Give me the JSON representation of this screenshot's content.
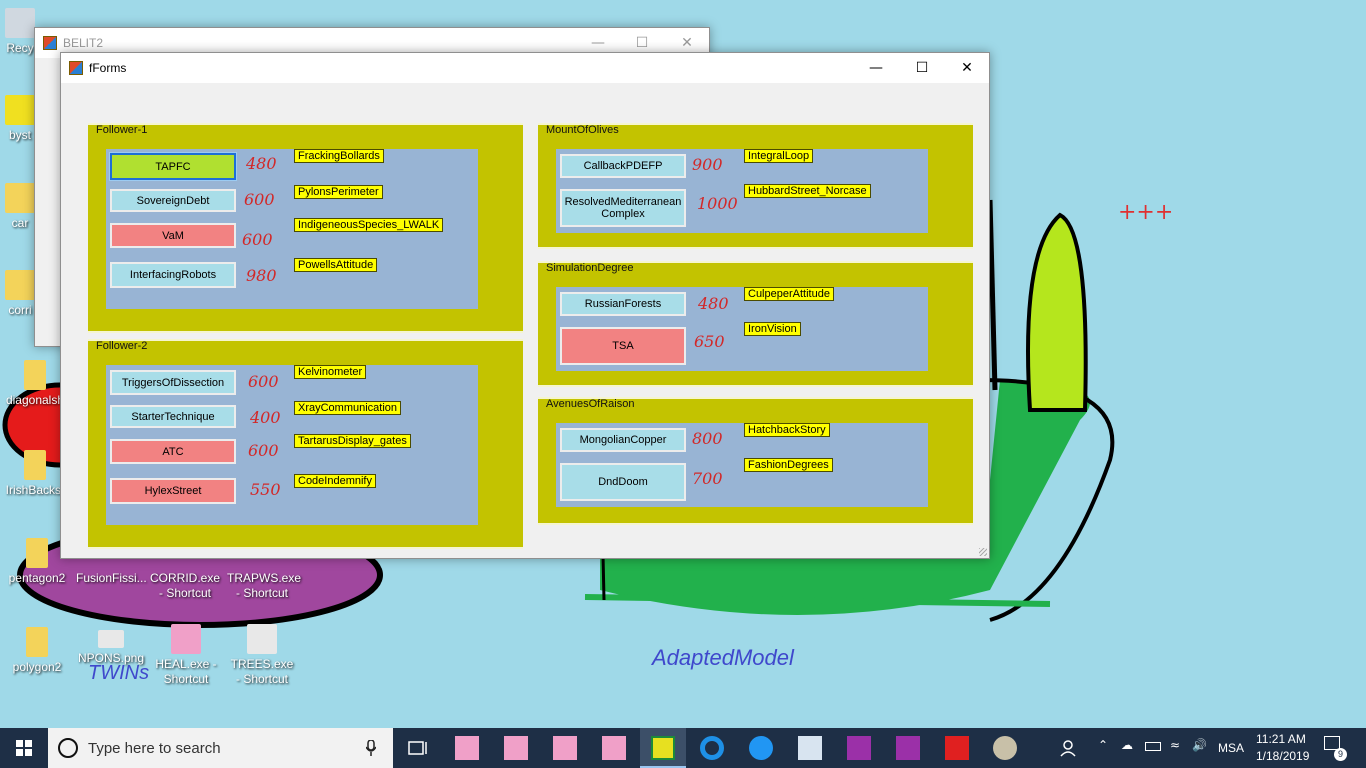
{
  "desktop": {
    "icons": [
      {
        "label": "Recy",
        "color": "#d0d8e0"
      },
      {
        "label": "byst",
        "color": "#f0e020"
      },
      {
        "label": "car",
        "color": "#f3d35a"
      },
      {
        "label": "corri",
        "color": "#f3d35a"
      },
      {
        "label": "diagonalsh",
        "color": "#f3d35a"
      },
      {
        "label": "IrishBackst",
        "color": "#f3d35a"
      },
      {
        "label": "pentagon2",
        "color": "#f3d35a"
      },
      {
        "label": "polygon2",
        "color": "#f3d35a"
      },
      {
        "label": "FusionFissi...",
        "color": "#e8e8e8"
      },
      {
        "label": "CORRID.exe - Shortcut",
        "color": "#e8e8e8"
      },
      {
        "label": "TRAPWS.exe - Shortcut",
        "color": "#e8e8e8"
      },
      {
        "label": "NPONS.png",
        "color": "#e8e8e8"
      },
      {
        "label": "HEAL.exe - Shortcut",
        "color": "#f0a0c8"
      },
      {
        "label": "TREES.exe - Shortcut",
        "color": "#e8e8e8"
      }
    ],
    "drawing_texts": {
      "crosses": "+++",
      "adapted_model": "AdaptedModel",
      "twins": "TWINs"
    }
  },
  "back_window": {
    "title": "BELIT2",
    "minimize": "—",
    "maximize": "☐",
    "close": "✕"
  },
  "front_window": {
    "title": "fForms",
    "minimize": "—",
    "maximize": "☐",
    "close": "✕"
  },
  "groups": [
    {
      "title": "Follower-1",
      "buttons": [
        {
          "label": "TAPFC",
          "style": "green"
        },
        {
          "label": "SovereignDebt",
          "style": "cyan"
        },
        {
          "label": "VaM",
          "style": "pink"
        },
        {
          "label": "InterfacingRobots",
          "style": "cyan"
        }
      ],
      "numbers": [
        "480",
        "600",
        "600",
        "980"
      ],
      "tags": [
        "FrackingBollards",
        "PylonsPerimeter",
        "IndigeneousSpecies_LWALK",
        "PowellsAttitude"
      ]
    },
    {
      "title": "Follower-2",
      "buttons": [
        {
          "label": "TriggersOfDissection",
          "style": "cyan"
        },
        {
          "label": "StarterTechnique",
          "style": "cyan"
        },
        {
          "label": "ATC",
          "style": "pink"
        },
        {
          "label": "HylexStreet",
          "style": "pink"
        }
      ],
      "numbers": [
        "600",
        "400",
        "600",
        "550"
      ],
      "tags": [
        "Kelvinometer",
        "XrayCommunication",
        "TartarusDisplay_gates",
        "CodeIndemnify"
      ]
    },
    {
      "title": "MountOfOlives",
      "buttons": [
        {
          "label": "CallbackPDEFP",
          "style": "cyan"
        },
        {
          "label": "ResolvedMediterranean Complex",
          "style": "cyan"
        }
      ],
      "numbers": [
        "900",
        "1000"
      ],
      "tags": [
        "IntegralLoop",
        "HubbardStreet_Norcase"
      ]
    },
    {
      "title": "SimulationDegree",
      "buttons": [
        {
          "label": "RussianForests",
          "style": "cyan"
        },
        {
          "label": "TSA",
          "style": "pink"
        }
      ],
      "numbers": [
        "480",
        "650"
      ],
      "tags": [
        "CulpeperAttitude",
        "IronVision"
      ]
    },
    {
      "title": "AvenuesOfRaison",
      "buttons": [
        {
          "label": "MongolianCopper",
          "style": "cyan"
        },
        {
          "label": "DndDoom",
          "style": "cyan"
        }
      ],
      "numbers": [
        "800",
        "700"
      ],
      "tags": [
        "HatchbackStory",
        "FashionDegrees"
      ]
    }
  ],
  "taskbar": {
    "search_placeholder": "Type here to search",
    "language": "MSA",
    "time": "11:21 AM",
    "date": "1/18/2019",
    "notifications": "9"
  }
}
